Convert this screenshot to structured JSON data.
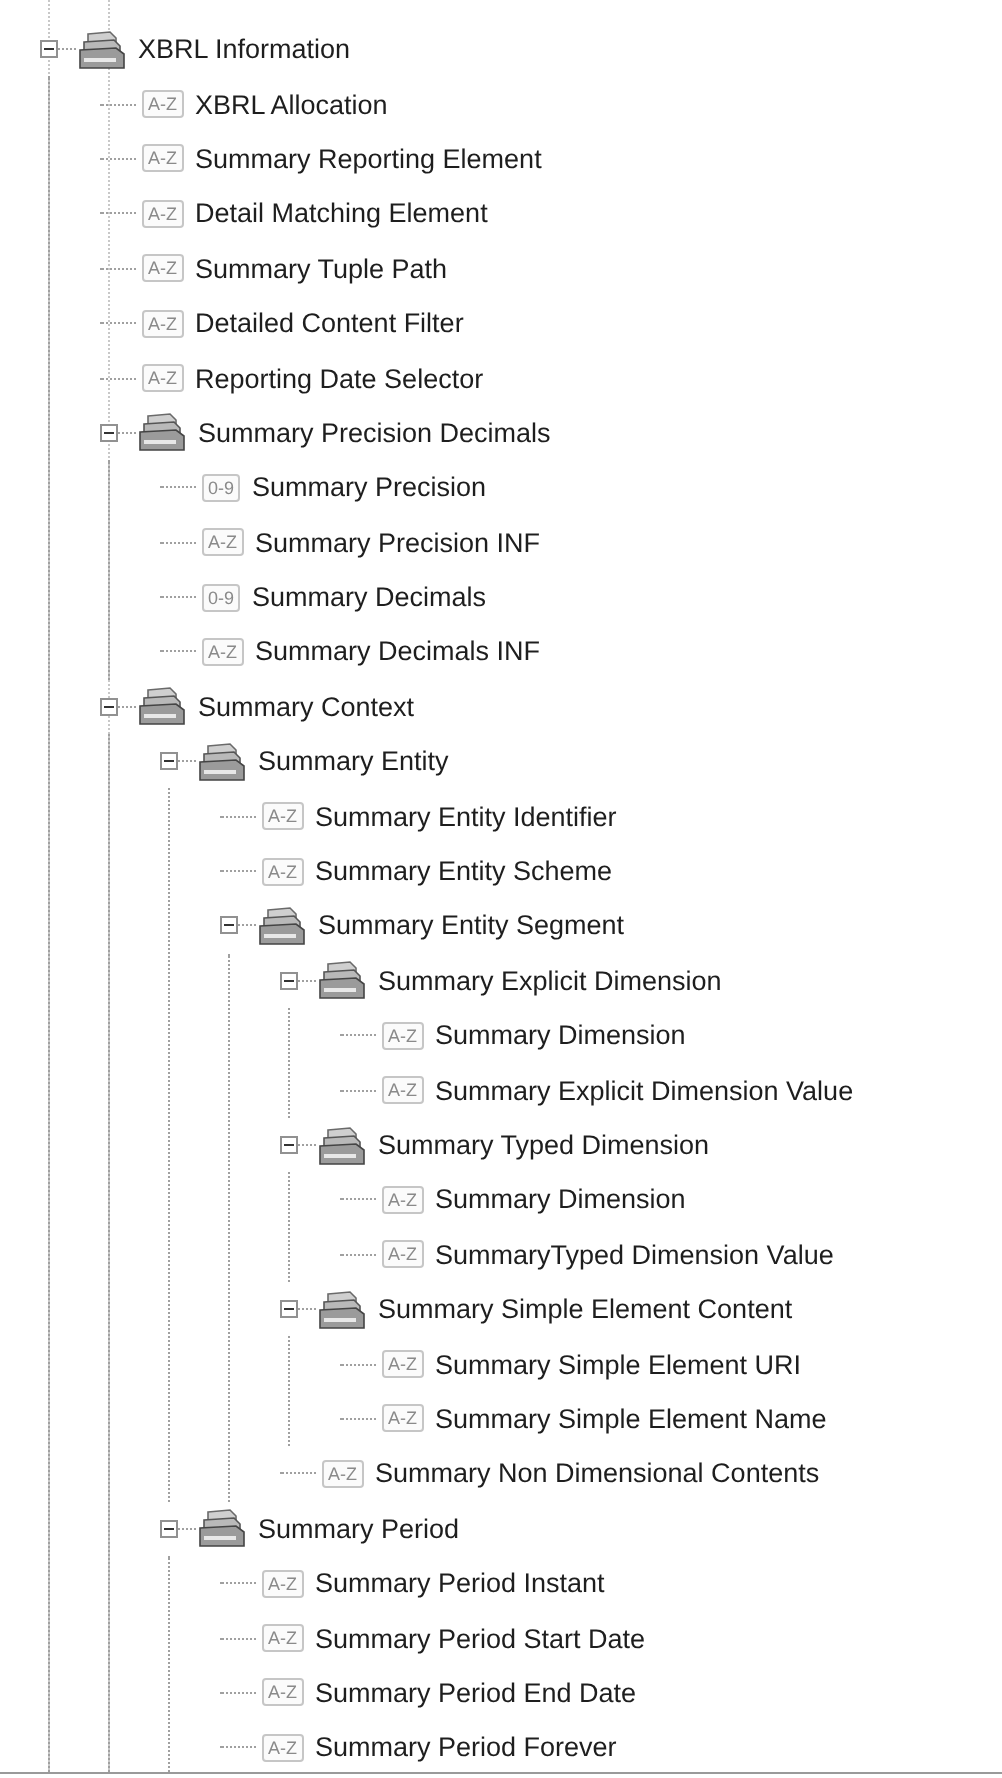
{
  "tree": [
    {
      "label": "XBRL Information",
      "kind": "folder",
      "expanded": true,
      "children": [
        {
          "label": "XBRL Allocation",
          "kind": "leaf",
          "type_tag": "A-Z"
        },
        {
          "label": "Summary Reporting Element",
          "kind": "leaf",
          "type_tag": "A-Z"
        },
        {
          "label": "Detail Matching Element",
          "kind": "leaf",
          "type_tag": "A-Z"
        },
        {
          "label": "Summary Tuple Path",
          "kind": "leaf",
          "type_tag": "A-Z"
        },
        {
          "label": "Detailed Content Filter",
          "kind": "leaf",
          "type_tag": "A-Z"
        },
        {
          "label": "Reporting Date Selector",
          "kind": "leaf",
          "type_tag": "A-Z"
        },
        {
          "label": "Summary Precision Decimals",
          "kind": "folder",
          "expanded": true,
          "children": [
            {
              "label": "Summary Precision",
              "kind": "leaf",
              "type_tag": "0-9"
            },
            {
              "label": "Summary Precision INF",
              "kind": "leaf",
              "type_tag": "A-Z"
            },
            {
              "label": "Summary Decimals",
              "kind": "leaf",
              "type_tag": "0-9"
            },
            {
              "label": "Summary Decimals INF",
              "kind": "leaf",
              "type_tag": "A-Z"
            }
          ]
        },
        {
          "label": "Summary Context",
          "kind": "folder",
          "expanded": true,
          "children": [
            {
              "label": "Summary Entity",
              "kind": "folder",
              "expanded": true,
              "children": [
                {
                  "label": "Summary Entity Identifier",
                  "kind": "leaf",
                  "type_tag": "A-Z"
                },
                {
                  "label": "Summary Entity Scheme",
                  "kind": "leaf",
                  "type_tag": "A-Z"
                },
                {
                  "label": "Summary Entity Segment",
                  "kind": "folder",
                  "expanded": true,
                  "children": [
                    {
                      "label": "Summary Explicit Dimension",
                      "kind": "folder",
                      "expanded": true,
                      "children": [
                        {
                          "label": "Summary Dimension",
                          "kind": "leaf",
                          "type_tag": "A-Z"
                        },
                        {
                          "label": "Summary Explicit Dimension Value",
                          "kind": "leaf",
                          "type_tag": "A-Z"
                        }
                      ]
                    },
                    {
                      "label": "Summary Typed Dimension",
                      "kind": "folder",
                      "expanded": true,
                      "children": [
                        {
                          "label": "Summary Dimension",
                          "kind": "leaf",
                          "type_tag": "A-Z"
                        },
                        {
                          "label": "SummaryTyped Dimension Value",
                          "kind": "leaf",
                          "type_tag": "A-Z"
                        }
                      ]
                    },
                    {
                      "label": "Summary Simple Element Content",
                      "kind": "folder",
                      "expanded": true,
                      "children": [
                        {
                          "label": "Summary Simple Element URI",
                          "kind": "leaf",
                          "type_tag": "A-Z"
                        },
                        {
                          "label": "Summary Simple Element Name",
                          "kind": "leaf",
                          "type_tag": "A-Z"
                        }
                      ]
                    },
                    {
                      "label": "Summary Non Dimensional Contents",
                      "kind": "leaf",
                      "type_tag": "A-Z"
                    }
                  ]
                }
              ]
            },
            {
              "label": "Summary Period",
              "kind": "folder",
              "expanded": true,
              "children": [
                {
                  "label": "Summary Period Instant",
                  "kind": "leaf",
                  "type_tag": "A-Z"
                },
                {
                  "label": "Summary Period Start Date",
                  "kind": "leaf",
                  "type_tag": "A-Z"
                },
                {
                  "label": "Summary Period End Date",
                  "kind": "leaf",
                  "type_tag": "A-Z"
                },
                {
                  "label": "Summary Period Forever",
                  "kind": "leaf",
                  "type_tag": "A-Z"
                }
              ]
            }
          ]
        }
      ]
    }
  ]
}
